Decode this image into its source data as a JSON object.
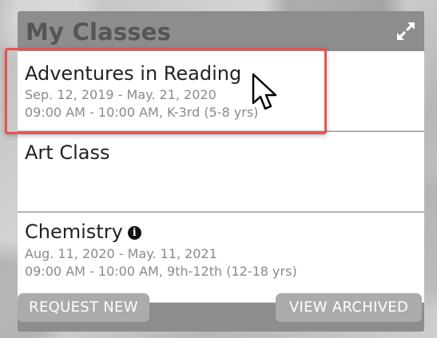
{
  "widget": {
    "title": "My Classes",
    "expand_icon": "expand-arrows-icon"
  },
  "classes": [
    {
      "name": "Adventures in Reading",
      "dates": "Sep. 12, 2019 - May. 21, 2020",
      "schedule": "09:00 AM - 10:00 AM, K-3rd (5-8 yrs)",
      "info_icon": false
    },
    {
      "name": "Art Class",
      "dates": "",
      "schedule": "",
      "info_icon": false
    },
    {
      "name": "Chemistry",
      "dates": "Aug. 11, 2020 - May. 11, 2021",
      "schedule": "09:00 AM - 10:00 AM, 9th-12th (12-18 yrs)",
      "info_icon": true,
      "info_icon_name": "info-circle-icon",
      "info_icon_glyph": "i"
    }
  ],
  "footer": {
    "request_new_label": "REQUEST NEW",
    "view_archived_label": "VIEW ARCHIVED"
  },
  "colors": {
    "highlight_border": "#e8534e",
    "widget_background": "#8d8d8d",
    "button_background": "#ababab"
  }
}
